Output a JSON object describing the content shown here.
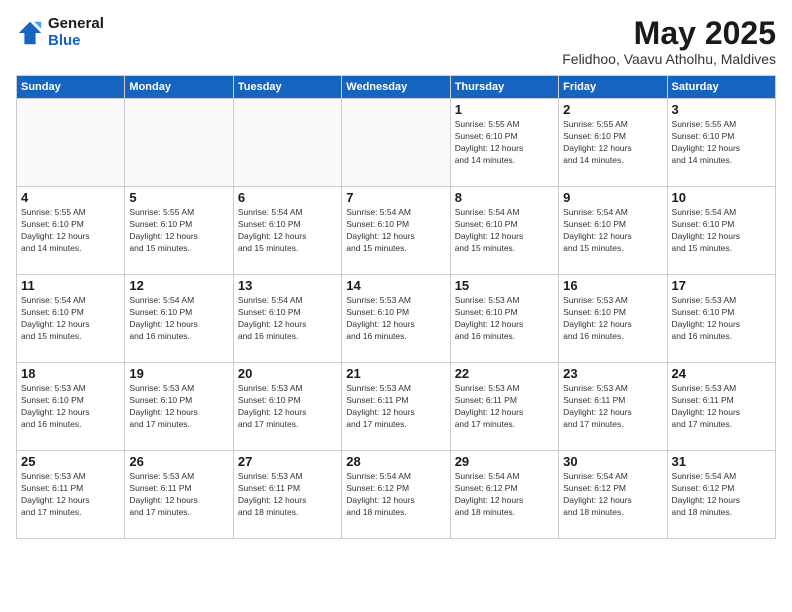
{
  "logo": {
    "general": "General",
    "blue": "Blue"
  },
  "title": "May 2025",
  "location": "Felidhoo, Vaavu Atholhu, Maldives",
  "weekdays": [
    "Sunday",
    "Monday",
    "Tuesday",
    "Wednesday",
    "Thursday",
    "Friday",
    "Saturday"
  ],
  "weeks": [
    [
      {
        "day": "",
        "info": ""
      },
      {
        "day": "",
        "info": ""
      },
      {
        "day": "",
        "info": ""
      },
      {
        "day": "",
        "info": ""
      },
      {
        "day": "1",
        "info": "Sunrise: 5:55 AM\nSunset: 6:10 PM\nDaylight: 12 hours\nand 14 minutes."
      },
      {
        "day": "2",
        "info": "Sunrise: 5:55 AM\nSunset: 6:10 PM\nDaylight: 12 hours\nand 14 minutes."
      },
      {
        "day": "3",
        "info": "Sunrise: 5:55 AM\nSunset: 6:10 PM\nDaylight: 12 hours\nand 14 minutes."
      }
    ],
    [
      {
        "day": "4",
        "info": "Sunrise: 5:55 AM\nSunset: 6:10 PM\nDaylight: 12 hours\nand 14 minutes."
      },
      {
        "day": "5",
        "info": "Sunrise: 5:55 AM\nSunset: 6:10 PM\nDaylight: 12 hours\nand 15 minutes."
      },
      {
        "day": "6",
        "info": "Sunrise: 5:54 AM\nSunset: 6:10 PM\nDaylight: 12 hours\nand 15 minutes."
      },
      {
        "day": "7",
        "info": "Sunrise: 5:54 AM\nSunset: 6:10 PM\nDaylight: 12 hours\nand 15 minutes."
      },
      {
        "day": "8",
        "info": "Sunrise: 5:54 AM\nSunset: 6:10 PM\nDaylight: 12 hours\nand 15 minutes."
      },
      {
        "day": "9",
        "info": "Sunrise: 5:54 AM\nSunset: 6:10 PM\nDaylight: 12 hours\nand 15 minutes."
      },
      {
        "day": "10",
        "info": "Sunrise: 5:54 AM\nSunset: 6:10 PM\nDaylight: 12 hours\nand 15 minutes."
      }
    ],
    [
      {
        "day": "11",
        "info": "Sunrise: 5:54 AM\nSunset: 6:10 PM\nDaylight: 12 hours\nand 15 minutes."
      },
      {
        "day": "12",
        "info": "Sunrise: 5:54 AM\nSunset: 6:10 PM\nDaylight: 12 hours\nand 16 minutes."
      },
      {
        "day": "13",
        "info": "Sunrise: 5:54 AM\nSunset: 6:10 PM\nDaylight: 12 hours\nand 16 minutes."
      },
      {
        "day": "14",
        "info": "Sunrise: 5:53 AM\nSunset: 6:10 PM\nDaylight: 12 hours\nand 16 minutes."
      },
      {
        "day": "15",
        "info": "Sunrise: 5:53 AM\nSunset: 6:10 PM\nDaylight: 12 hours\nand 16 minutes."
      },
      {
        "day": "16",
        "info": "Sunrise: 5:53 AM\nSunset: 6:10 PM\nDaylight: 12 hours\nand 16 minutes."
      },
      {
        "day": "17",
        "info": "Sunrise: 5:53 AM\nSunset: 6:10 PM\nDaylight: 12 hours\nand 16 minutes."
      }
    ],
    [
      {
        "day": "18",
        "info": "Sunrise: 5:53 AM\nSunset: 6:10 PM\nDaylight: 12 hours\nand 16 minutes."
      },
      {
        "day": "19",
        "info": "Sunrise: 5:53 AM\nSunset: 6:10 PM\nDaylight: 12 hours\nand 17 minutes."
      },
      {
        "day": "20",
        "info": "Sunrise: 5:53 AM\nSunset: 6:10 PM\nDaylight: 12 hours\nand 17 minutes."
      },
      {
        "day": "21",
        "info": "Sunrise: 5:53 AM\nSunset: 6:11 PM\nDaylight: 12 hours\nand 17 minutes."
      },
      {
        "day": "22",
        "info": "Sunrise: 5:53 AM\nSunset: 6:11 PM\nDaylight: 12 hours\nand 17 minutes."
      },
      {
        "day": "23",
        "info": "Sunrise: 5:53 AM\nSunset: 6:11 PM\nDaylight: 12 hours\nand 17 minutes."
      },
      {
        "day": "24",
        "info": "Sunrise: 5:53 AM\nSunset: 6:11 PM\nDaylight: 12 hours\nand 17 minutes."
      }
    ],
    [
      {
        "day": "25",
        "info": "Sunrise: 5:53 AM\nSunset: 6:11 PM\nDaylight: 12 hours\nand 17 minutes."
      },
      {
        "day": "26",
        "info": "Sunrise: 5:53 AM\nSunset: 6:11 PM\nDaylight: 12 hours\nand 17 minutes."
      },
      {
        "day": "27",
        "info": "Sunrise: 5:53 AM\nSunset: 6:11 PM\nDaylight: 12 hours\nand 18 minutes."
      },
      {
        "day": "28",
        "info": "Sunrise: 5:54 AM\nSunset: 6:12 PM\nDaylight: 12 hours\nand 18 minutes."
      },
      {
        "day": "29",
        "info": "Sunrise: 5:54 AM\nSunset: 6:12 PM\nDaylight: 12 hours\nand 18 minutes."
      },
      {
        "day": "30",
        "info": "Sunrise: 5:54 AM\nSunset: 6:12 PM\nDaylight: 12 hours\nand 18 minutes."
      },
      {
        "day": "31",
        "info": "Sunrise: 5:54 AM\nSunset: 6:12 PM\nDaylight: 12 hours\nand 18 minutes."
      }
    ]
  ]
}
